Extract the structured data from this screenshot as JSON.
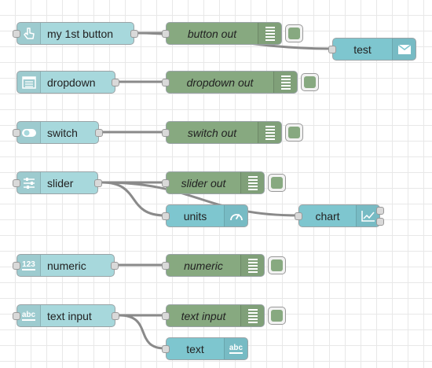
{
  "nodes": {
    "button": {
      "label": "my 1st button",
      "icon": "hand-pointer-icon"
    },
    "button_out": {
      "label": "button out",
      "icon": "debug-list-icon"
    },
    "test": {
      "label": "test",
      "icon": "envelope-icon"
    },
    "dropdown": {
      "label": "dropdown",
      "icon": "list-icon"
    },
    "dropdown_out": {
      "label": "dropdown out",
      "icon": "debug-list-icon"
    },
    "switch": {
      "label": "switch",
      "icon": "toggle-icon"
    },
    "switch_out": {
      "label": "switch out",
      "icon": "debug-list-icon"
    },
    "slider": {
      "label": "slider",
      "icon": "sliders-icon"
    },
    "slider_out": {
      "label": "slider out",
      "icon": "debug-list-icon"
    },
    "units": {
      "label": "units",
      "icon": "gauge-icon"
    },
    "chart": {
      "label": "chart",
      "icon": "line-chart-icon"
    },
    "numeric": {
      "label": "numeric",
      "icon": "numeric-icon",
      "icon_text": "123"
    },
    "numeric_out": {
      "label": "numeric",
      "icon": "debug-list-icon"
    },
    "text_input": {
      "label": "text input",
      "icon": "abc-icon",
      "icon_text": "abc"
    },
    "text_input_out": {
      "label": "text input",
      "icon": "debug-list-icon"
    },
    "text": {
      "label": "text",
      "icon": "abc-icon",
      "icon_text": "abc"
    }
  },
  "colors": {
    "input_node": "#a7d8dc",
    "output_node": "#7ec6cf",
    "debug_node": "#87a980",
    "wire": "#8a8a8a"
  }
}
